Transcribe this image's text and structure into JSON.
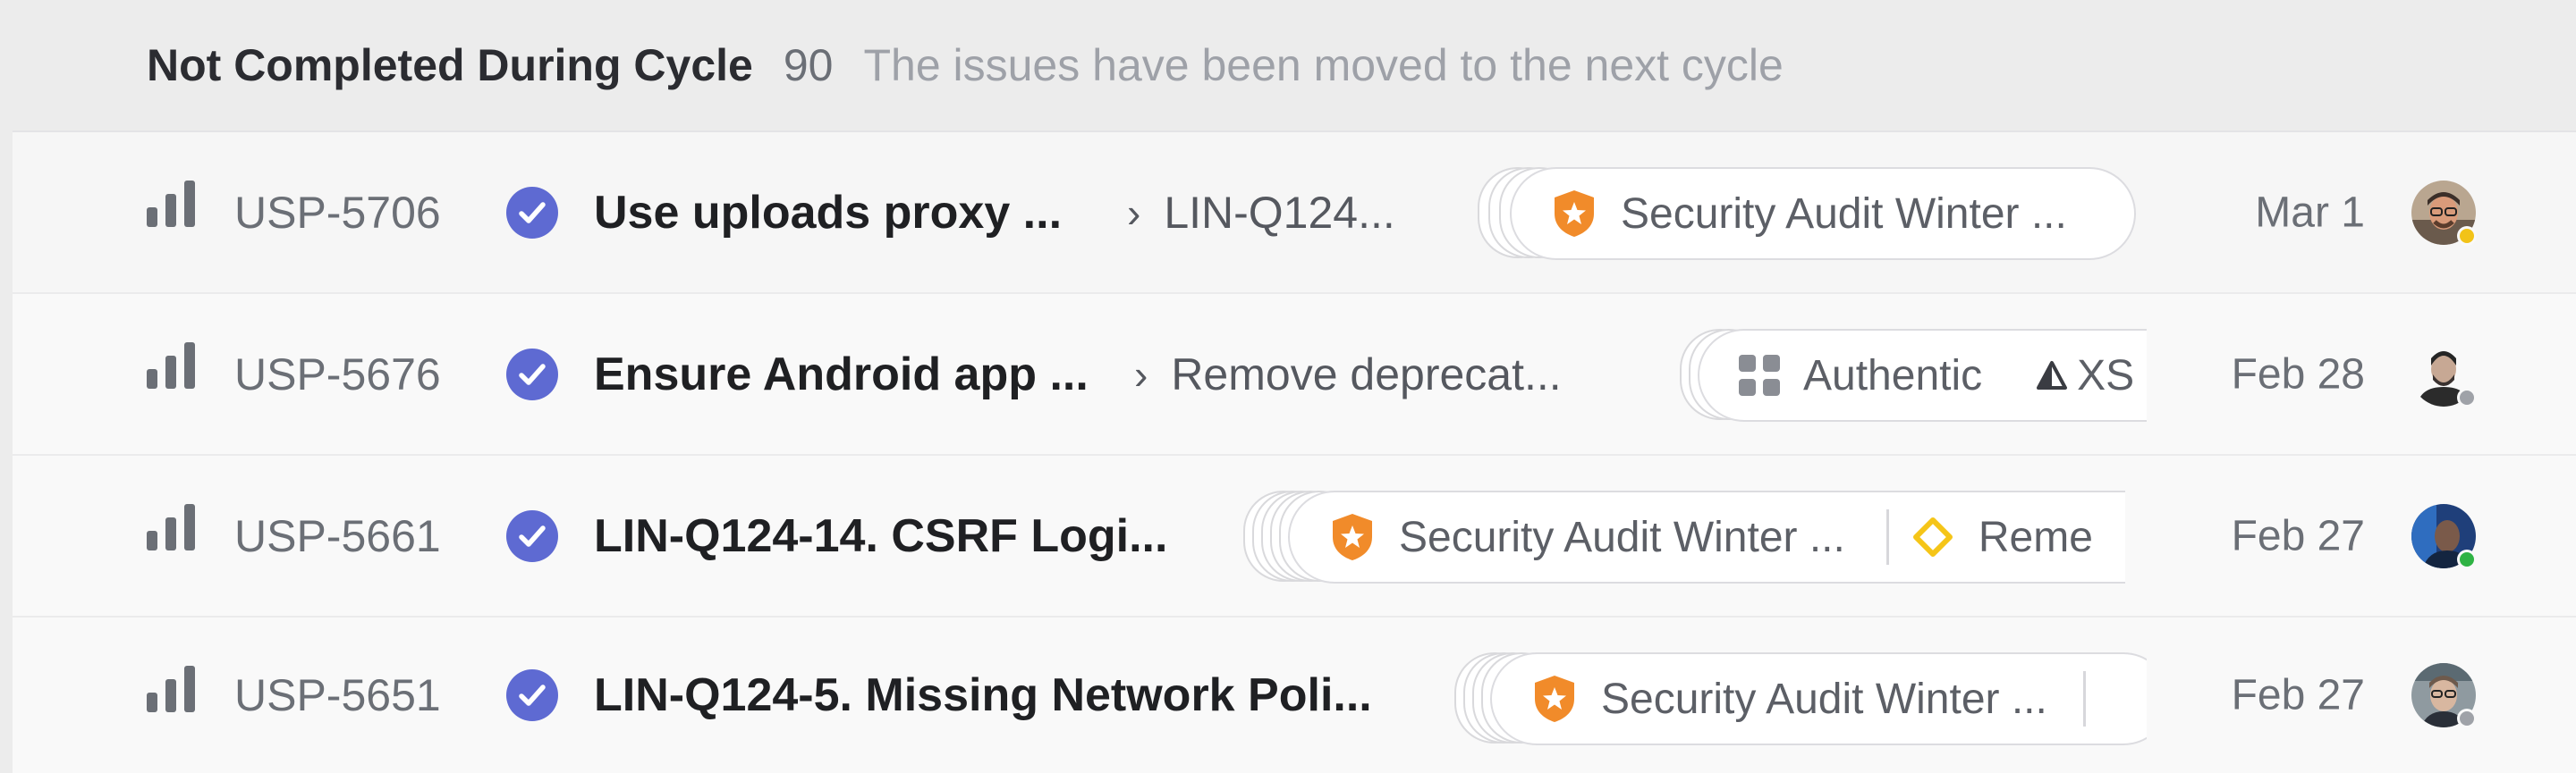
{
  "group": {
    "title": "Not Completed During Cycle",
    "count": "90",
    "description": "The issues have been moved to the next cycle"
  },
  "colors": {
    "accent": "#5e6ad2",
    "project_orange": "#f18b2a",
    "milestone_yellow": "#f5c518"
  },
  "issues": [
    {
      "id": "USP-5706",
      "status": "done",
      "title": "Use uploads proxy ...",
      "parent": "LIN-Q124...",
      "labels": [
        {
          "icon": "shield-star-icon",
          "text": "Security Audit Winter ..."
        }
      ],
      "date": "Mar 1",
      "assignee_presence": "away"
    },
    {
      "id": "USP-5676",
      "status": "done",
      "title": "Ensure Android app ...",
      "parent": "Remove deprecat...",
      "labels": [
        {
          "icon": "grid-icon",
          "text": "Authentic"
        },
        {
          "icon": "triangle-icon",
          "text": "XS"
        }
      ],
      "date": "Feb 28",
      "assignee_presence": "offline"
    },
    {
      "id": "USP-5661",
      "status": "done",
      "title": "LIN-Q124-14. CSRF Logi...",
      "parent": "",
      "labels": [
        {
          "icon": "shield-star-icon",
          "text": "Security Audit Winter ..."
        },
        {
          "icon": "diamond-icon",
          "text": "Reme"
        }
      ],
      "date": "Feb 27",
      "assignee_presence": "online"
    },
    {
      "id": "USP-5651",
      "status": "done",
      "title": "LIN-Q124-5. Missing Network Poli...",
      "parent": "",
      "labels": [
        {
          "icon": "shield-star-icon",
          "text": "Security Audit Winter ..."
        }
      ],
      "date": "Feb 27",
      "assignee_presence": "offline"
    }
  ]
}
